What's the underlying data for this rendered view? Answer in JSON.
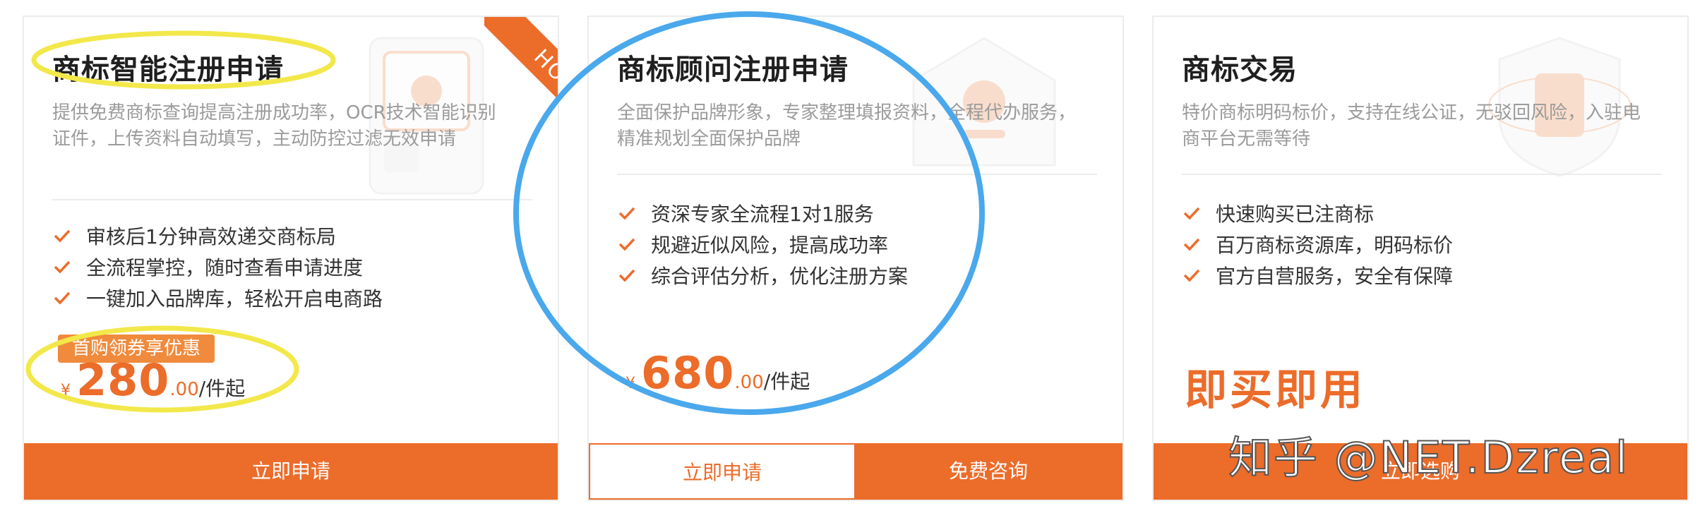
{
  "colors": {
    "accent": "#ec6c2a",
    "highlight_yellow": "#f2e84a",
    "circle_blue": "#4aa8ec",
    "check": "#ec6c2a"
  },
  "cards": [
    {
      "title": "商标智能注册申请",
      "ribbon": "HOT",
      "description": "提供免费商标查询提高注册成功率，OCR技术智能识别证件，上传资料自动填写，主动防控过滤无效申请",
      "features": [
        "审核后1分钟高效递交商标局",
        "全流程掌控，随时查看申请进度",
        "一键加入品牌库，轻松开启电商路"
      ],
      "promo": "首购领券享优惠",
      "price": {
        "currency": "¥",
        "integer": "280",
        "decimal": ".00",
        "unit": "/件起"
      },
      "buttons": [
        "立即申请"
      ]
    },
    {
      "title": "商标顾问注册申请",
      "description": "全面保护品牌形象，专家整理填报资料，全程代办服务，精准规划全面保护品牌",
      "features": [
        "资深专家全流程1对1服务",
        "规避近似风险，提高成功率",
        "综合评估分析，优化注册方案"
      ],
      "price": {
        "currency": "¥",
        "integer": "680",
        "decimal": ".00",
        "unit": "/件起"
      },
      "buttons": [
        "立即申请",
        "免费咨询"
      ]
    },
    {
      "title": "商标交易",
      "description": "特价商标明码标价，支持在线公证，无驳回风险，入驻电商平台无需等待",
      "features": [
        "快速购买已注商标",
        "百万商标资源库，明码标价",
        "官方自营服务，安全有保障"
      ],
      "slogan": "即买即用",
      "buttons": [
        "立即选购"
      ]
    }
  ],
  "watermark": "知乎 @NET.Dzreal",
  "icons": [
    "check-icon",
    "box-illustration",
    "house-illustration",
    "shield-illustration"
  ]
}
